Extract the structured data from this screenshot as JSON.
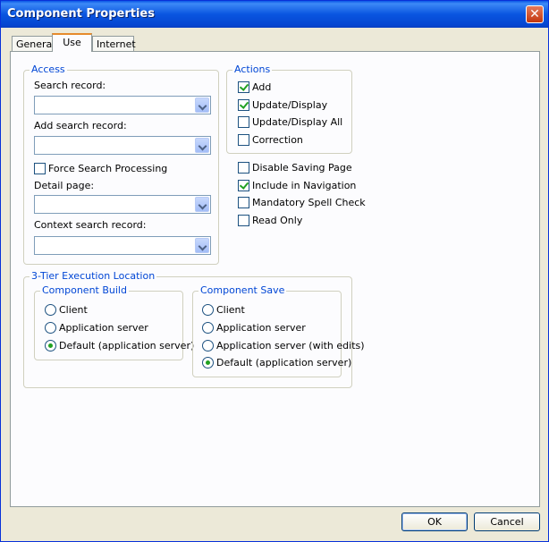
{
  "window": {
    "title": "Component Properties",
    "close_glyph": "✕"
  },
  "tabs": [
    {
      "label": "General"
    },
    {
      "label": "Use"
    },
    {
      "label": "Internet"
    }
  ],
  "access": {
    "legend": "Access",
    "search_record_label": "Search record:",
    "search_record_value": "",
    "add_search_record_label": "Add search record:",
    "add_search_record_value": "",
    "force_search_label": "Force Search Processing",
    "force_search_checked": false,
    "detail_page_label": "Detail page:",
    "detail_page_value": "",
    "context_search_label": "Context search record:",
    "context_search_value": ""
  },
  "actions": {
    "legend": "Actions",
    "items": [
      {
        "label": "Add",
        "checked": true
      },
      {
        "label": "Update/Display",
        "checked": true
      },
      {
        "label": "Update/Display All",
        "checked": false
      },
      {
        "label": "Correction",
        "checked": false
      }
    ]
  },
  "options": [
    {
      "label": "Disable Saving Page",
      "checked": false
    },
    {
      "label": "Include in Navigation",
      "checked": true
    },
    {
      "label": "Mandatory Spell Check",
      "checked": false
    },
    {
      "label": "Read Only",
      "checked": false
    }
  ],
  "execution": {
    "legend": "3-Tier Execution Location",
    "build": {
      "legend": "Component Build",
      "options": [
        "Client",
        "Application server",
        "Default (application server)"
      ],
      "selected": "Default (application server)"
    },
    "save": {
      "legend": "Component Save",
      "options": [
        "Client",
        "Application server",
        "Application server (with edits)",
        "Default (application server)"
      ],
      "selected": "Default (application server)"
    }
  },
  "buttons": {
    "ok": "OK",
    "cancel": "Cancel"
  },
  "colors": {
    "title_bar": "#0a55e0",
    "legend_text": "#0046d5",
    "check_mark": "#21a121"
  }
}
